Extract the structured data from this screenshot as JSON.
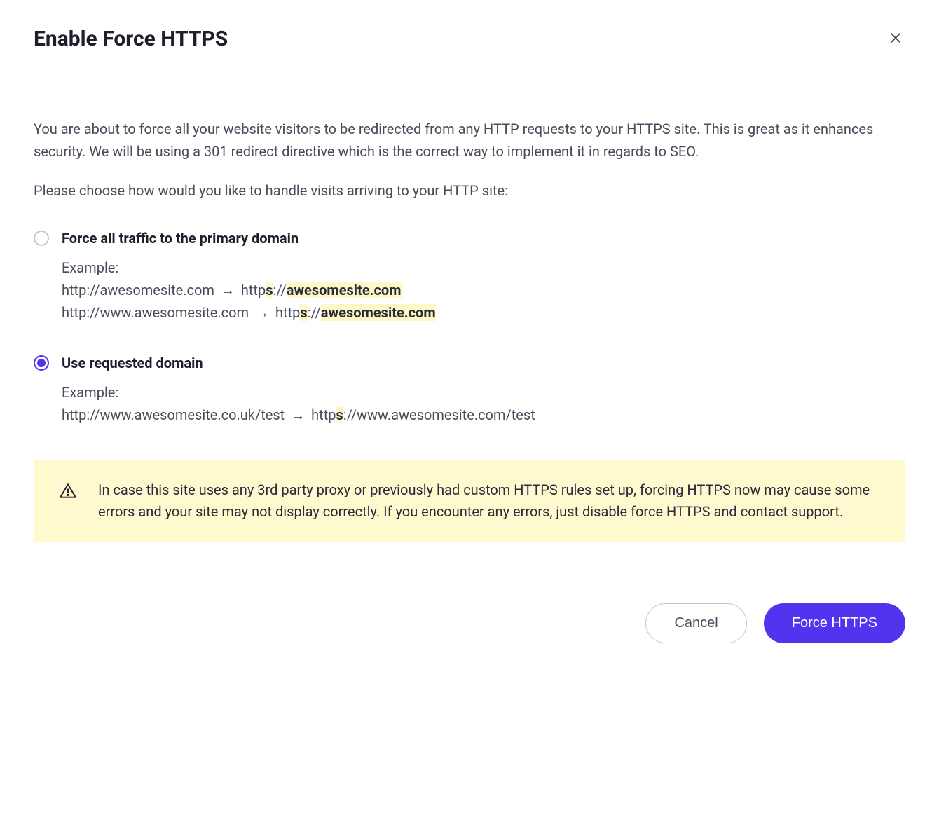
{
  "header": {
    "title": "Enable Force HTTPS"
  },
  "intro": "You are about to force all your website visitors to be redirected from any HTTP requests to your HTTPS site. This is great as it enhances security. We will be using a 301 redirect directive which is the correct way to implement it in regards to SEO.",
  "prompt": "Please choose how would you like to handle visits arriving to your HTTP site:",
  "options": {
    "primary": {
      "label": "Force all traffic to the primary domain",
      "example_label": "Example:",
      "line1_from": "http://awesomesite.com",
      "line1_to_prefix": "http",
      "line1_to_s": "s",
      "line1_to_sep": "://",
      "line1_to_domain": "awesomesite.com",
      "line2_from": "http://www.awesomesite.com",
      "line2_to_prefix": "http",
      "line2_to_s": "s",
      "line2_to_sep": "://",
      "line2_to_domain": "awesomesite.com"
    },
    "requested": {
      "label": "Use requested domain",
      "example_label": "Example:",
      "line1_from": "http://www.awesomesite.co.uk/test",
      "line1_to_prefix": "http",
      "line1_to_s": "s",
      "line1_to_rest": "://www.awesomesite.com/test"
    }
  },
  "warning": "In case this site uses any 3rd party proxy or previously had custom HTTPS rules set up, forcing HTTPS now may cause some errors and your site may not display correctly. If you encounter any errors, just disable force HTTPS and contact support.",
  "footer": {
    "cancel": "Cancel",
    "confirm": "Force HTTPS"
  }
}
